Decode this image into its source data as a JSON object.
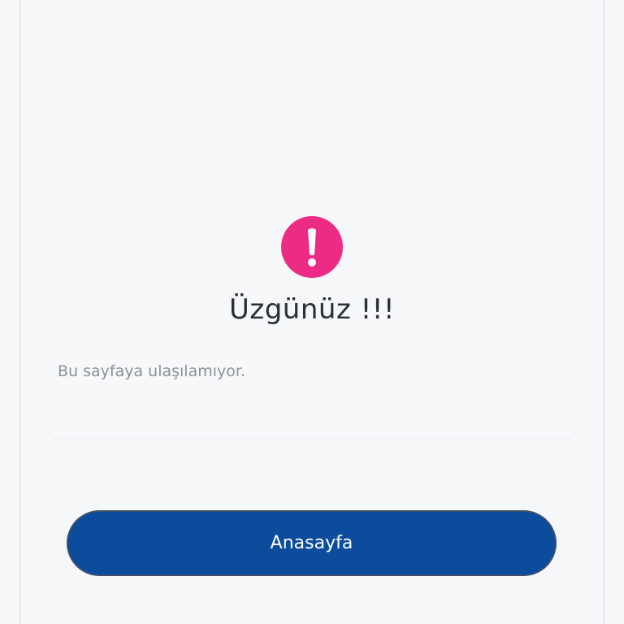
{
  "error": {
    "icon": "exclamation-icon",
    "icon_color": "#ec2c84",
    "title": "Üzgünüz !!!",
    "message": "Bu sayfaya ulaşılamıyor."
  },
  "actions": {
    "home_label": "Anasayfa",
    "button_color": "#0b4d9c"
  }
}
